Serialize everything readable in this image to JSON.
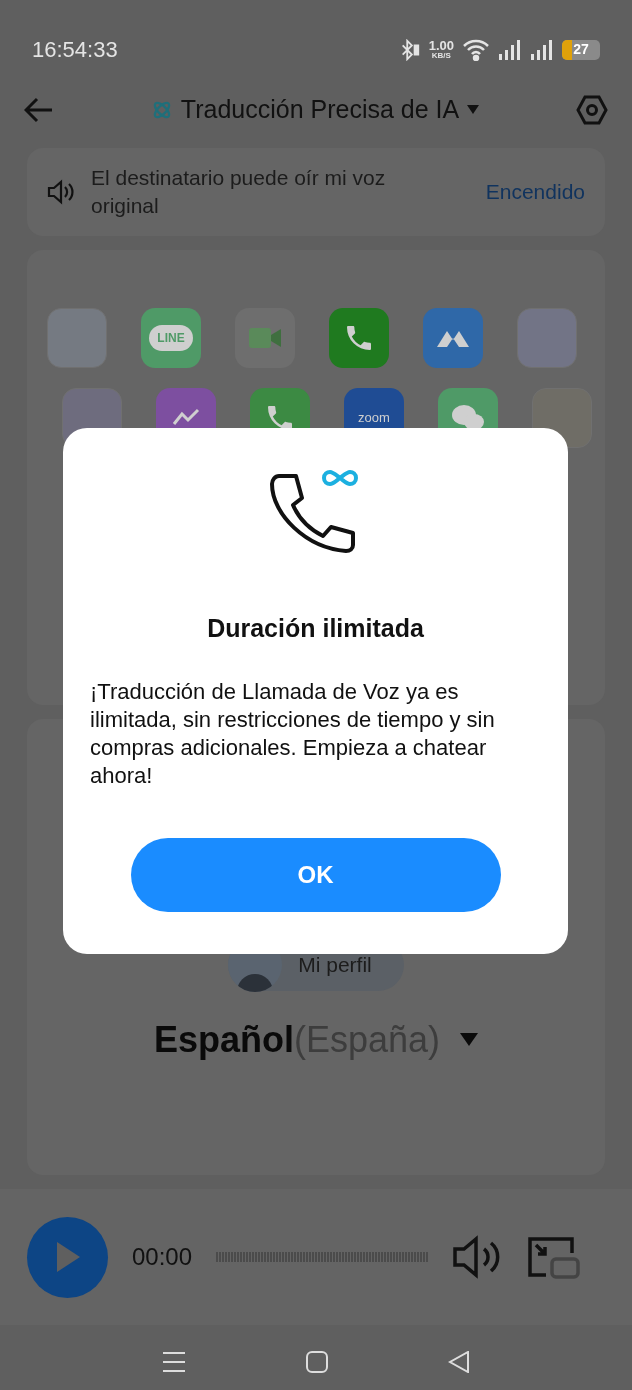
{
  "status_bar": {
    "time": "16:54:33",
    "net_speed": "1.00",
    "net_unit": "KB/S",
    "battery": "27"
  },
  "header": {
    "title": "Traducción Precisa de IA"
  },
  "voice_setting": {
    "label": "El destinatario puede oír mi voz original",
    "value": "Encendido"
  },
  "apps": [
    [
      {
        "kind": "faded",
        "color": "#757a82"
      },
      {
        "kind": "chat",
        "color": "#4f9a67",
        "label": "LINE"
      },
      {
        "kind": "video",
        "color": "#6e6e6e"
      },
      {
        "kind": "phone",
        "color": "#1f7a1f"
      },
      {
        "kind": "peaks",
        "color": "#2f68a8"
      },
      {
        "kind": "faded",
        "color": "#727486"
      }
    ],
    [
      {
        "kind": "faded",
        "color": "#6e6c7e"
      },
      {
        "kind": "bolt",
        "color": "#7d4fa0"
      },
      {
        "kind": "phone",
        "color": "#3c8a43"
      },
      {
        "kind": "text",
        "color": "#1f4c94",
        "label": "zoom"
      },
      {
        "kind": "chat",
        "color": "#4f9a67"
      },
      {
        "kind": "faded",
        "color": "#6f6d66"
      }
    ]
  ],
  "profile": {
    "label": "Mi perfil"
  },
  "language": {
    "name": "Español",
    "region": "(España)"
  },
  "player": {
    "time": "00:00"
  },
  "dialog": {
    "title": "Duración ilimitada",
    "message": "¡Traducción de Llamada de Voz ya es ilimitada, sin restricciones de tiempo y sin compras adicionales. Empieza a chatear ahora!",
    "button": "OK"
  }
}
